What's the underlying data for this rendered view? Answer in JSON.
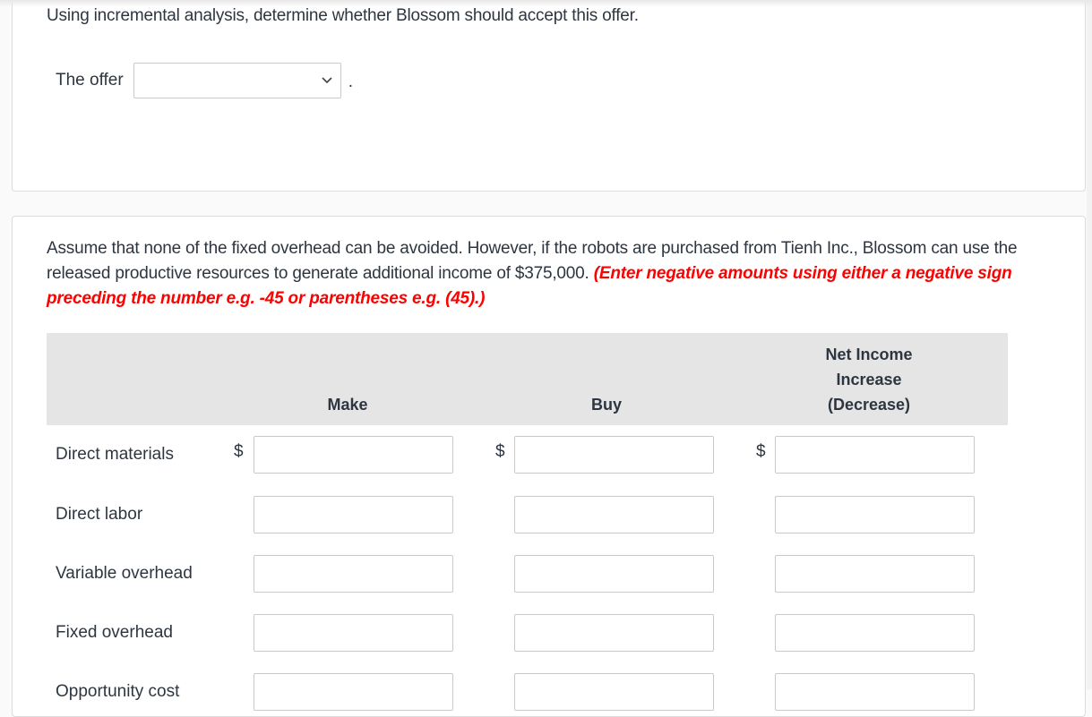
{
  "part1": {
    "prompt": "Using incremental analysis, determine whether Blossom should accept this offer.",
    "offer_label": "The offer",
    "offer_select_value": "",
    "offer_trailing": "."
  },
  "part2": {
    "paragraph_main": "Assume that none of the fixed overhead can be avoided. However, if the robots are purchased from Tienh Inc., Blossom can use the released productive resources to generate additional income of $375,000.",
    "paragraph_instruction": "(Enter negative amounts using either a negative sign preceding the number e.g. -45 or parentheses e.g. (45).)",
    "instruction_color": "#ff0000",
    "table": {
      "columns": [
        "Make",
        "Buy",
        "Net Income Increase (Decrease)"
      ],
      "column_net_lines": [
        "Net Income",
        "Increase",
        "(Decrease)"
      ],
      "currency_symbol": "$",
      "rows": [
        {
          "label": "Direct materials",
          "make": "",
          "buy": "",
          "net": "",
          "show_currency": true
        },
        {
          "label": "Direct labor",
          "make": "",
          "buy": "",
          "net": "",
          "show_currency": false
        },
        {
          "label": "Variable overhead",
          "make": "",
          "buy": "",
          "net": "",
          "show_currency": false
        },
        {
          "label": "Fixed overhead",
          "make": "",
          "buy": "",
          "net": "",
          "show_currency": false
        },
        {
          "label": "Opportunity cost",
          "make": "",
          "buy": "",
          "net": "",
          "show_currency": false
        }
      ]
    }
  }
}
